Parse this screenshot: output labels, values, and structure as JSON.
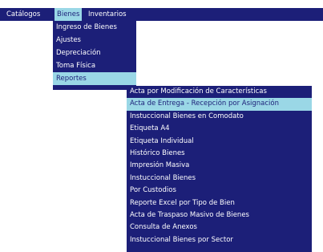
{
  "menubar": {
    "items": [
      {
        "label": "Catálogos"
      },
      {
        "label": "Bienes"
      },
      {
        "label": "Inventarios"
      }
    ]
  },
  "bienes_menu": {
    "items": [
      {
        "label": "Ingreso de Bienes"
      },
      {
        "label": "Ajustes"
      },
      {
        "label": "Depreciación"
      },
      {
        "label": "Toma Física"
      },
      {
        "label": "Reportes"
      }
    ]
  },
  "reportes_menu": {
    "items": [
      {
        "label": "Acta por Modificación de Características"
      },
      {
        "label": "Acta de Entrega - Recepción por Asignación"
      },
      {
        "label": "Instuccional Bienes en Comodato"
      },
      {
        "label": "Etiqueta A4"
      },
      {
        "label": "Etiqueta Individual"
      },
      {
        "label": "Histórico Bienes"
      },
      {
        "label": "Impresión Masiva"
      },
      {
        "label": "Instuccional Bienes"
      },
      {
        "label": "Por Custodios"
      },
      {
        "label": "Reporte Excel por Tipo de Bien"
      },
      {
        "label": "Acta de Traspaso Masivo de Bienes"
      },
      {
        "label": "Consulta de Anexos"
      },
      {
        "label": "Instuccional Bienes por Sector"
      }
    ]
  },
  "colors": {
    "menu_bg": "#1c1f78",
    "highlight_bg": "#9ad7e6",
    "text": "#ffffff"
  }
}
